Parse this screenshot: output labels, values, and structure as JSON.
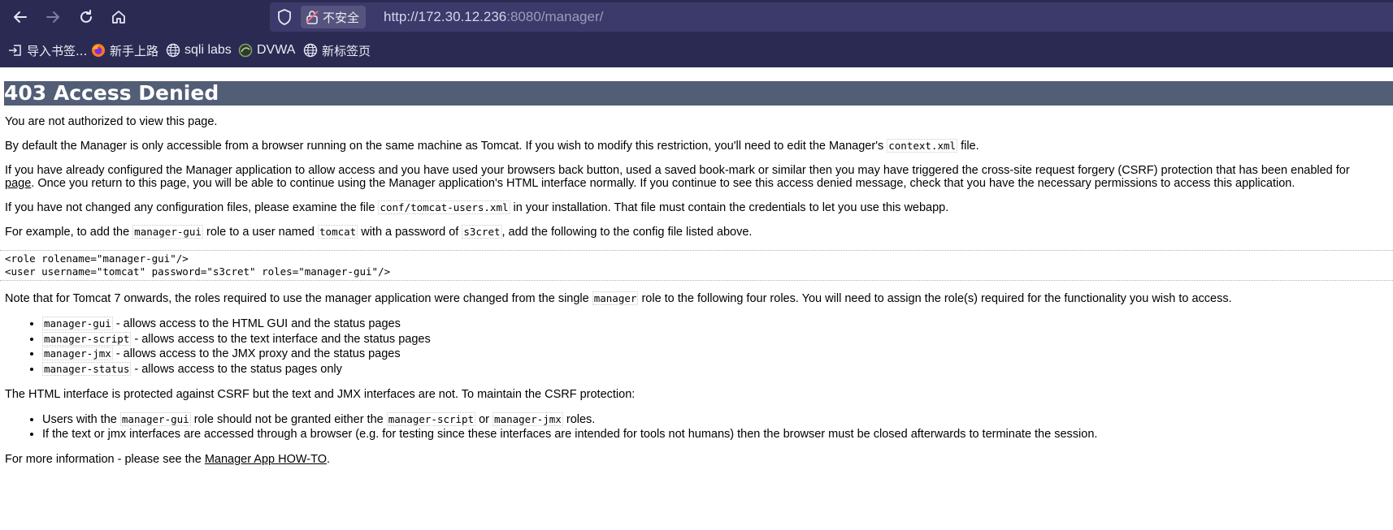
{
  "browser": {
    "security_label": "不安全",
    "url_host": "http://172.30.12.236",
    "url_port_path": ":8080/manager/",
    "bookmarks": [
      {
        "label": "导入书签...",
        "icon": "import-icon"
      },
      {
        "label": "新手上路",
        "icon": "firefox-icon"
      },
      {
        "label": "sqli labs",
        "icon": "globe-icon"
      },
      {
        "label": "DVWA",
        "icon": "dvwa-icon"
      },
      {
        "label": "新标签页",
        "icon": "globe-icon"
      }
    ]
  },
  "page": {
    "title": "403 Access Denied",
    "p1": "You are not authorized to view this page.",
    "p2_a": "By default the Manager is only accessible from a browser running on the same machine as Tomcat. If you wish to modify this restriction, you'll need to edit the Manager's ",
    "p2_code": "context.xml",
    "p2_b": " file.",
    "p3_a": "If you have already configured the Manager application to allow access and you have used your browsers back button, used a saved book-mark or similar then you may have triggered the cross-site request forgery (CSRF) protection that has been enabled for",
    "p3_link": "page",
    "p3_b": ". Once you return to this page, you will be able to continue using the Manager application's HTML interface normally. If you continue to see this access denied message, check that you have the necessary permissions to access this application.",
    "p4_a": "If you have not changed any configuration files, please examine the file ",
    "p4_code": "conf/tomcat-users.xml",
    "p4_b": " in your installation. That file must contain the credentials to let you use this webapp.",
    "p5_a": "For example, to add the ",
    "p5_code1": "manager-gui",
    "p5_b": " role to a user named ",
    "p5_code2": "tomcat",
    "p5_c": " with a password of ",
    "p5_code3": "s3cret",
    "p5_d": ", add the following to the config file listed above.",
    "pre_line1": "<role rolename=\"manager-gui\"/>",
    "pre_line2": "<user username=\"tomcat\" password=\"s3cret\" roles=\"manager-gui\"/>",
    "p6_a": "Note that for Tomcat 7 onwards, the roles required to use the manager application were changed from the single ",
    "p6_code": "manager",
    "p6_b": " role to the following four roles. You will need to assign the role(s) required for the functionality you wish to access.",
    "roles": [
      {
        "code": "manager-gui",
        "text": " - allows access to the HTML GUI and the status pages"
      },
      {
        "code": "manager-script",
        "text": " - allows access to the text interface and the status pages"
      },
      {
        "code": "manager-jmx",
        "text": " - allows access to the JMX proxy and the status pages"
      },
      {
        "code": "manager-status",
        "text": " - allows access to the status pages only"
      }
    ],
    "p7": "The HTML interface is protected against CSRF but the text and JMX interfaces are not. To maintain the CSRF protection:",
    "csrf_1_a": "Users with the ",
    "csrf_1_code1": "manager-gui",
    "csrf_1_b": " role should not be granted either the ",
    "csrf_1_code2": "manager-script",
    "csrf_1_c": " or ",
    "csrf_1_code3": "manager-jmx",
    "csrf_1_d": " roles.",
    "csrf_2": "If the text or jmx interfaces are accessed through a browser (e.g. for testing since these interfaces are intended for tools not humans) then the browser must be closed afterwards to terminate the session.",
    "p8_a": "For more information - please see the ",
    "p8_link": "Manager App HOW-TO",
    "p8_b": "."
  }
}
